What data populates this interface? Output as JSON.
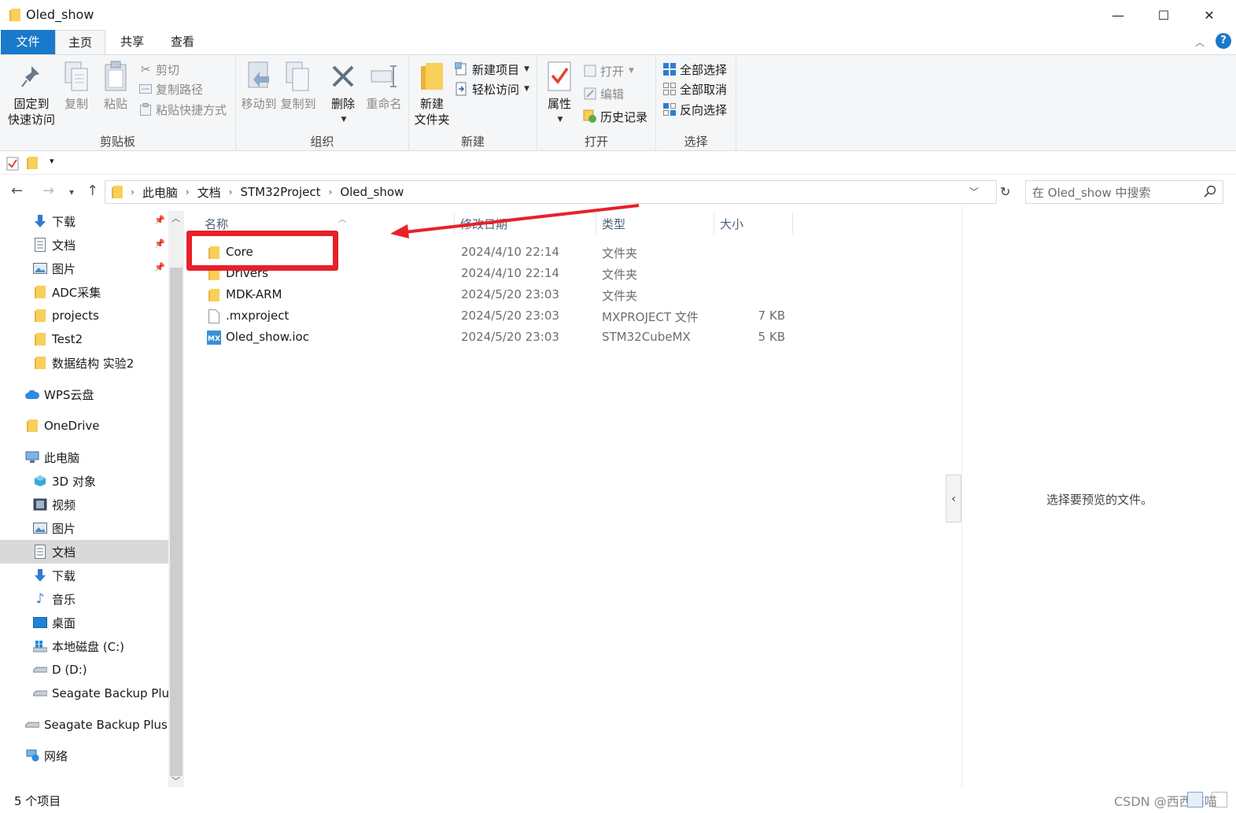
{
  "window": {
    "title": "Oled_show",
    "controls": {
      "minimize": "—",
      "maximize": "☐",
      "close": "✕"
    }
  },
  "ribbon_tabs": {
    "file": "文件",
    "home": "主页",
    "share": "共享",
    "view": "查看",
    "help": "?"
  },
  "ribbon": {
    "clipboard": {
      "label": "剪贴板",
      "pin_line1": "固定到",
      "pin_line2": "快速访问",
      "copy": "复制",
      "paste": "粘贴",
      "cut": "剪切",
      "copy_path": "复制路径",
      "paste_shortcut": "粘贴快捷方式"
    },
    "organize": {
      "label": "组织",
      "move_to": "移动到",
      "copy_to": "复制到",
      "delete": "删除",
      "rename": "重命名"
    },
    "new": {
      "label": "新建",
      "new_folder_line1": "新建",
      "new_folder_line2": "文件夹",
      "new_item": "新建项目",
      "easy_access": "轻松访问"
    },
    "open": {
      "label": "打开",
      "properties": "属性",
      "open": "打开",
      "edit": "编辑",
      "history": "历史记录"
    },
    "select": {
      "label": "选择",
      "select_all": "全部选择",
      "select_none": "全部取消",
      "invert": "反向选择"
    }
  },
  "address": {
    "crumbs": [
      "此电脑",
      "文档",
      "STM32Project",
      "Oled_show"
    ],
    "search_placeholder": "在 Oled_show 中搜索"
  },
  "nav_pane": {
    "items": [
      {
        "label": "下载",
        "icon": "download-arrow-icon",
        "pinned": true
      },
      {
        "label": "文档",
        "icon": "document-icon",
        "pinned": true
      },
      {
        "label": "图片",
        "icon": "picture-icon",
        "pinned": true
      },
      {
        "label": "ADC采集",
        "icon": "folder-icon"
      },
      {
        "label": "projects",
        "icon": "folder-icon"
      },
      {
        "label": "Test2",
        "icon": "folder-icon"
      },
      {
        "label": "数据结构 实验2",
        "icon": "folder-icon"
      },
      {
        "label": "WPS云盘",
        "icon": "cloud-icon"
      },
      {
        "label": "OneDrive",
        "icon": "folder-icon"
      },
      {
        "label": "此电脑",
        "icon": "computer-icon"
      },
      {
        "label": "3D 对象",
        "icon": "cube-icon"
      },
      {
        "label": "视频",
        "icon": "video-icon"
      },
      {
        "label": "图片",
        "icon": "picture-icon"
      },
      {
        "label": "文档",
        "icon": "document-icon",
        "selected": true
      },
      {
        "label": "下载",
        "icon": "download-arrow-icon"
      },
      {
        "label": "音乐",
        "icon": "music-note-icon"
      },
      {
        "label": "桌面",
        "icon": "desktop-icon"
      },
      {
        "label": "本地磁盘 (C:)",
        "icon": "windows-drive-icon"
      },
      {
        "label": "D (D:)",
        "icon": "drive-icon"
      },
      {
        "label": "Seagate Backup Plus",
        "icon": "drive-icon"
      },
      {
        "label": "Seagate Backup Plus D",
        "icon": "drive-icon"
      },
      {
        "label": "网络",
        "icon": "network-icon"
      }
    ]
  },
  "file_list": {
    "columns": {
      "name": "名称",
      "date": "修改日期",
      "type": "类型",
      "size": "大小"
    },
    "rows": [
      {
        "name": "Core",
        "date": "2024/4/10 22:14",
        "type": "文件夹",
        "size": "",
        "icon": "folder-icon"
      },
      {
        "name": "Drivers",
        "date": "2024/4/10 22:14",
        "type": "文件夹",
        "size": "",
        "icon": "folder-icon"
      },
      {
        "name": "MDK-ARM",
        "date": "2024/5/20 23:03",
        "type": "文件夹",
        "size": "",
        "icon": "folder-icon"
      },
      {
        "name": ".mxproject",
        "date": "2024/5/20 23:03",
        "type": "MXPROJECT 文件",
        "size": "7 KB",
        "icon": "blank-file-icon"
      },
      {
        "name": "Oled_show.ioc",
        "date": "2024/5/20 23:03",
        "type": "STM32CubeMX",
        "size": "5 KB",
        "icon": "stm32cubemx-icon"
      }
    ]
  },
  "preview_pane": {
    "message": "选择要预览的文件。"
  },
  "status_bar": {
    "item_count": "5 个项目"
  },
  "watermark": "CSDN @西西喵喵",
  "annotation_color": "#e8202a",
  "accent_color": "#1979ca"
}
